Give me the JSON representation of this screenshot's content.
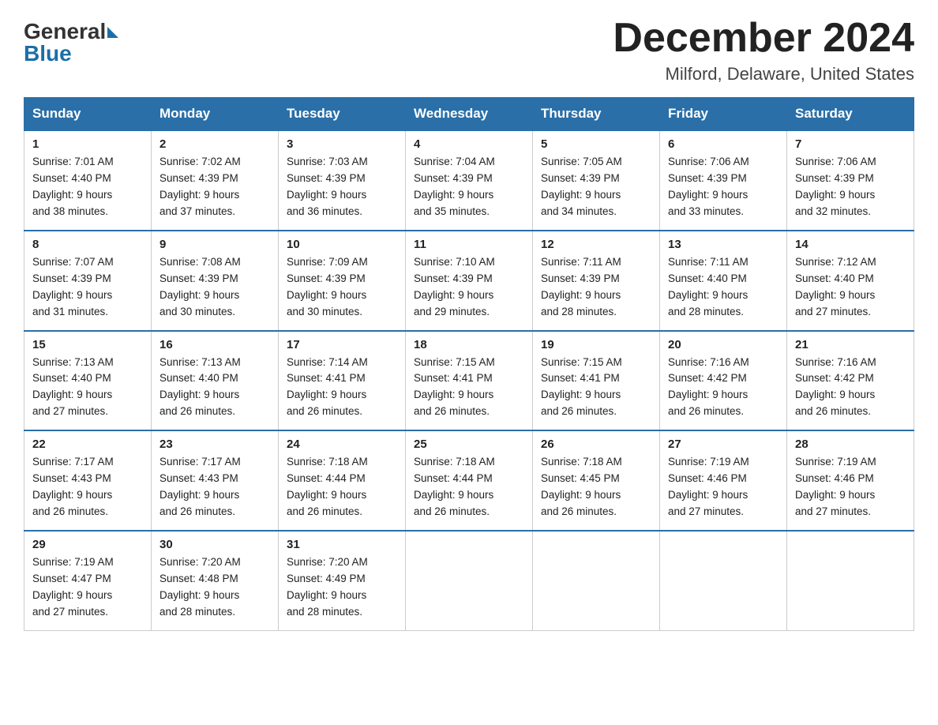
{
  "logo": {
    "general": "General",
    "blue": "Blue",
    "arrow": true
  },
  "title": "December 2024",
  "subtitle": "Milford, Delaware, United States",
  "days_of_week": [
    "Sunday",
    "Monday",
    "Tuesday",
    "Wednesday",
    "Thursday",
    "Friday",
    "Saturday"
  ],
  "weeks": [
    [
      {
        "day": "1",
        "sunrise": "7:01 AM",
        "sunset": "4:40 PM",
        "daylight": "9 hours and 38 minutes."
      },
      {
        "day": "2",
        "sunrise": "7:02 AM",
        "sunset": "4:39 PM",
        "daylight": "9 hours and 37 minutes."
      },
      {
        "day": "3",
        "sunrise": "7:03 AM",
        "sunset": "4:39 PM",
        "daylight": "9 hours and 36 minutes."
      },
      {
        "day": "4",
        "sunrise": "7:04 AM",
        "sunset": "4:39 PM",
        "daylight": "9 hours and 35 minutes."
      },
      {
        "day": "5",
        "sunrise": "7:05 AM",
        "sunset": "4:39 PM",
        "daylight": "9 hours and 34 minutes."
      },
      {
        "day": "6",
        "sunrise": "7:06 AM",
        "sunset": "4:39 PM",
        "daylight": "9 hours and 33 minutes."
      },
      {
        "day": "7",
        "sunrise": "7:06 AM",
        "sunset": "4:39 PM",
        "daylight": "9 hours and 32 minutes."
      }
    ],
    [
      {
        "day": "8",
        "sunrise": "7:07 AM",
        "sunset": "4:39 PM",
        "daylight": "9 hours and 31 minutes."
      },
      {
        "day": "9",
        "sunrise": "7:08 AM",
        "sunset": "4:39 PM",
        "daylight": "9 hours and 30 minutes."
      },
      {
        "day": "10",
        "sunrise": "7:09 AM",
        "sunset": "4:39 PM",
        "daylight": "9 hours and 30 minutes."
      },
      {
        "day": "11",
        "sunrise": "7:10 AM",
        "sunset": "4:39 PM",
        "daylight": "9 hours and 29 minutes."
      },
      {
        "day": "12",
        "sunrise": "7:11 AM",
        "sunset": "4:39 PM",
        "daylight": "9 hours and 28 minutes."
      },
      {
        "day": "13",
        "sunrise": "7:11 AM",
        "sunset": "4:40 PM",
        "daylight": "9 hours and 28 minutes."
      },
      {
        "day": "14",
        "sunrise": "7:12 AM",
        "sunset": "4:40 PM",
        "daylight": "9 hours and 27 minutes."
      }
    ],
    [
      {
        "day": "15",
        "sunrise": "7:13 AM",
        "sunset": "4:40 PM",
        "daylight": "9 hours and 27 minutes."
      },
      {
        "day": "16",
        "sunrise": "7:13 AM",
        "sunset": "4:40 PM",
        "daylight": "9 hours and 26 minutes."
      },
      {
        "day": "17",
        "sunrise": "7:14 AM",
        "sunset": "4:41 PM",
        "daylight": "9 hours and 26 minutes."
      },
      {
        "day": "18",
        "sunrise": "7:15 AM",
        "sunset": "4:41 PM",
        "daylight": "9 hours and 26 minutes."
      },
      {
        "day": "19",
        "sunrise": "7:15 AM",
        "sunset": "4:41 PM",
        "daylight": "9 hours and 26 minutes."
      },
      {
        "day": "20",
        "sunrise": "7:16 AM",
        "sunset": "4:42 PM",
        "daylight": "9 hours and 26 minutes."
      },
      {
        "day": "21",
        "sunrise": "7:16 AM",
        "sunset": "4:42 PM",
        "daylight": "9 hours and 26 minutes."
      }
    ],
    [
      {
        "day": "22",
        "sunrise": "7:17 AM",
        "sunset": "4:43 PM",
        "daylight": "9 hours and 26 minutes."
      },
      {
        "day": "23",
        "sunrise": "7:17 AM",
        "sunset": "4:43 PM",
        "daylight": "9 hours and 26 minutes."
      },
      {
        "day": "24",
        "sunrise": "7:18 AM",
        "sunset": "4:44 PM",
        "daylight": "9 hours and 26 minutes."
      },
      {
        "day": "25",
        "sunrise": "7:18 AM",
        "sunset": "4:44 PM",
        "daylight": "9 hours and 26 minutes."
      },
      {
        "day": "26",
        "sunrise": "7:18 AM",
        "sunset": "4:45 PM",
        "daylight": "9 hours and 26 minutes."
      },
      {
        "day": "27",
        "sunrise": "7:19 AM",
        "sunset": "4:46 PM",
        "daylight": "9 hours and 27 minutes."
      },
      {
        "day": "28",
        "sunrise": "7:19 AM",
        "sunset": "4:46 PM",
        "daylight": "9 hours and 27 minutes."
      }
    ],
    [
      {
        "day": "29",
        "sunrise": "7:19 AM",
        "sunset": "4:47 PM",
        "daylight": "9 hours and 27 minutes."
      },
      {
        "day": "30",
        "sunrise": "7:20 AM",
        "sunset": "4:48 PM",
        "daylight": "9 hours and 28 minutes."
      },
      {
        "day": "31",
        "sunrise": "7:20 AM",
        "sunset": "4:49 PM",
        "daylight": "9 hours and 28 minutes."
      },
      null,
      null,
      null,
      null
    ]
  ],
  "labels": {
    "sunrise": "Sunrise:",
    "sunset": "Sunset:",
    "daylight": "Daylight:"
  }
}
